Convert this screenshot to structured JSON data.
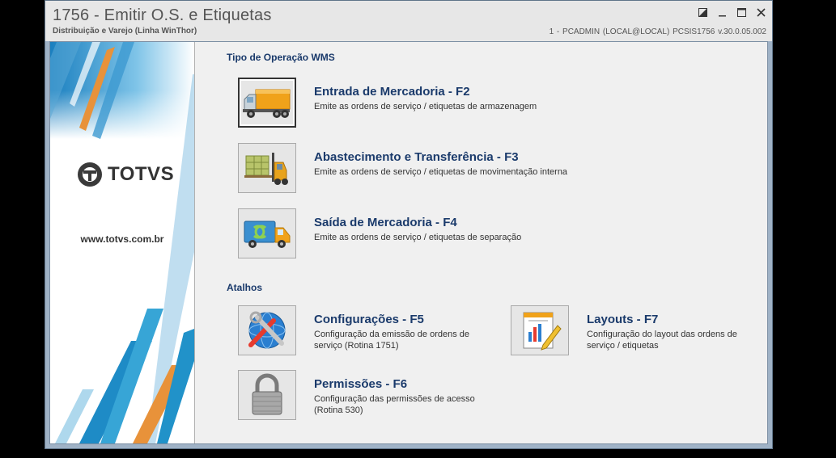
{
  "window": {
    "title": "1756 - Emitir O.S. e Etiquetas",
    "subtitle": "Distribuição e Varejo (Linha WinThor)",
    "info": "1 - PCADMIN (LOCAL@LOCAL)   PCSIS1756  v.30.0.05.002"
  },
  "sidebar": {
    "brand": "TOTVS",
    "url": "www.totvs.com.br"
  },
  "sections": {
    "wms": "Tipo de Operação WMS",
    "shortcuts": "Atalhos"
  },
  "wms_items": [
    {
      "title": "Entrada de Mercadoria - F2",
      "desc": "Emite as ordens de serviço / etiquetas de armazenagem",
      "icon": "truck-loaded-icon"
    },
    {
      "title": "Abastecimento e Transferência - F3",
      "desc": "Emite as ordens de serviço / etiquetas de movimentação interna",
      "icon": "forklift-icon"
    },
    {
      "title": "Saída de Mercadoria - F4",
      "desc": "Emite as ordens de serviço / etiquetas de separação",
      "icon": "delivery-truck-icon"
    }
  ],
  "shortcuts": [
    {
      "title": "Configurações - F5",
      "desc": "Configuração da emissão de ordens de serviço (Rotina 1751)",
      "icon": "tools-globe-icon"
    },
    {
      "title": "Layouts - F7",
      "desc": "Configuração do layout das ordens de serviço / etiquetas",
      "icon": "document-edit-icon"
    },
    {
      "title": "Permissões - F6",
      "desc": "Configuração das permissões de acesso (Rotina 530)",
      "icon": "padlock-icon"
    }
  ]
}
